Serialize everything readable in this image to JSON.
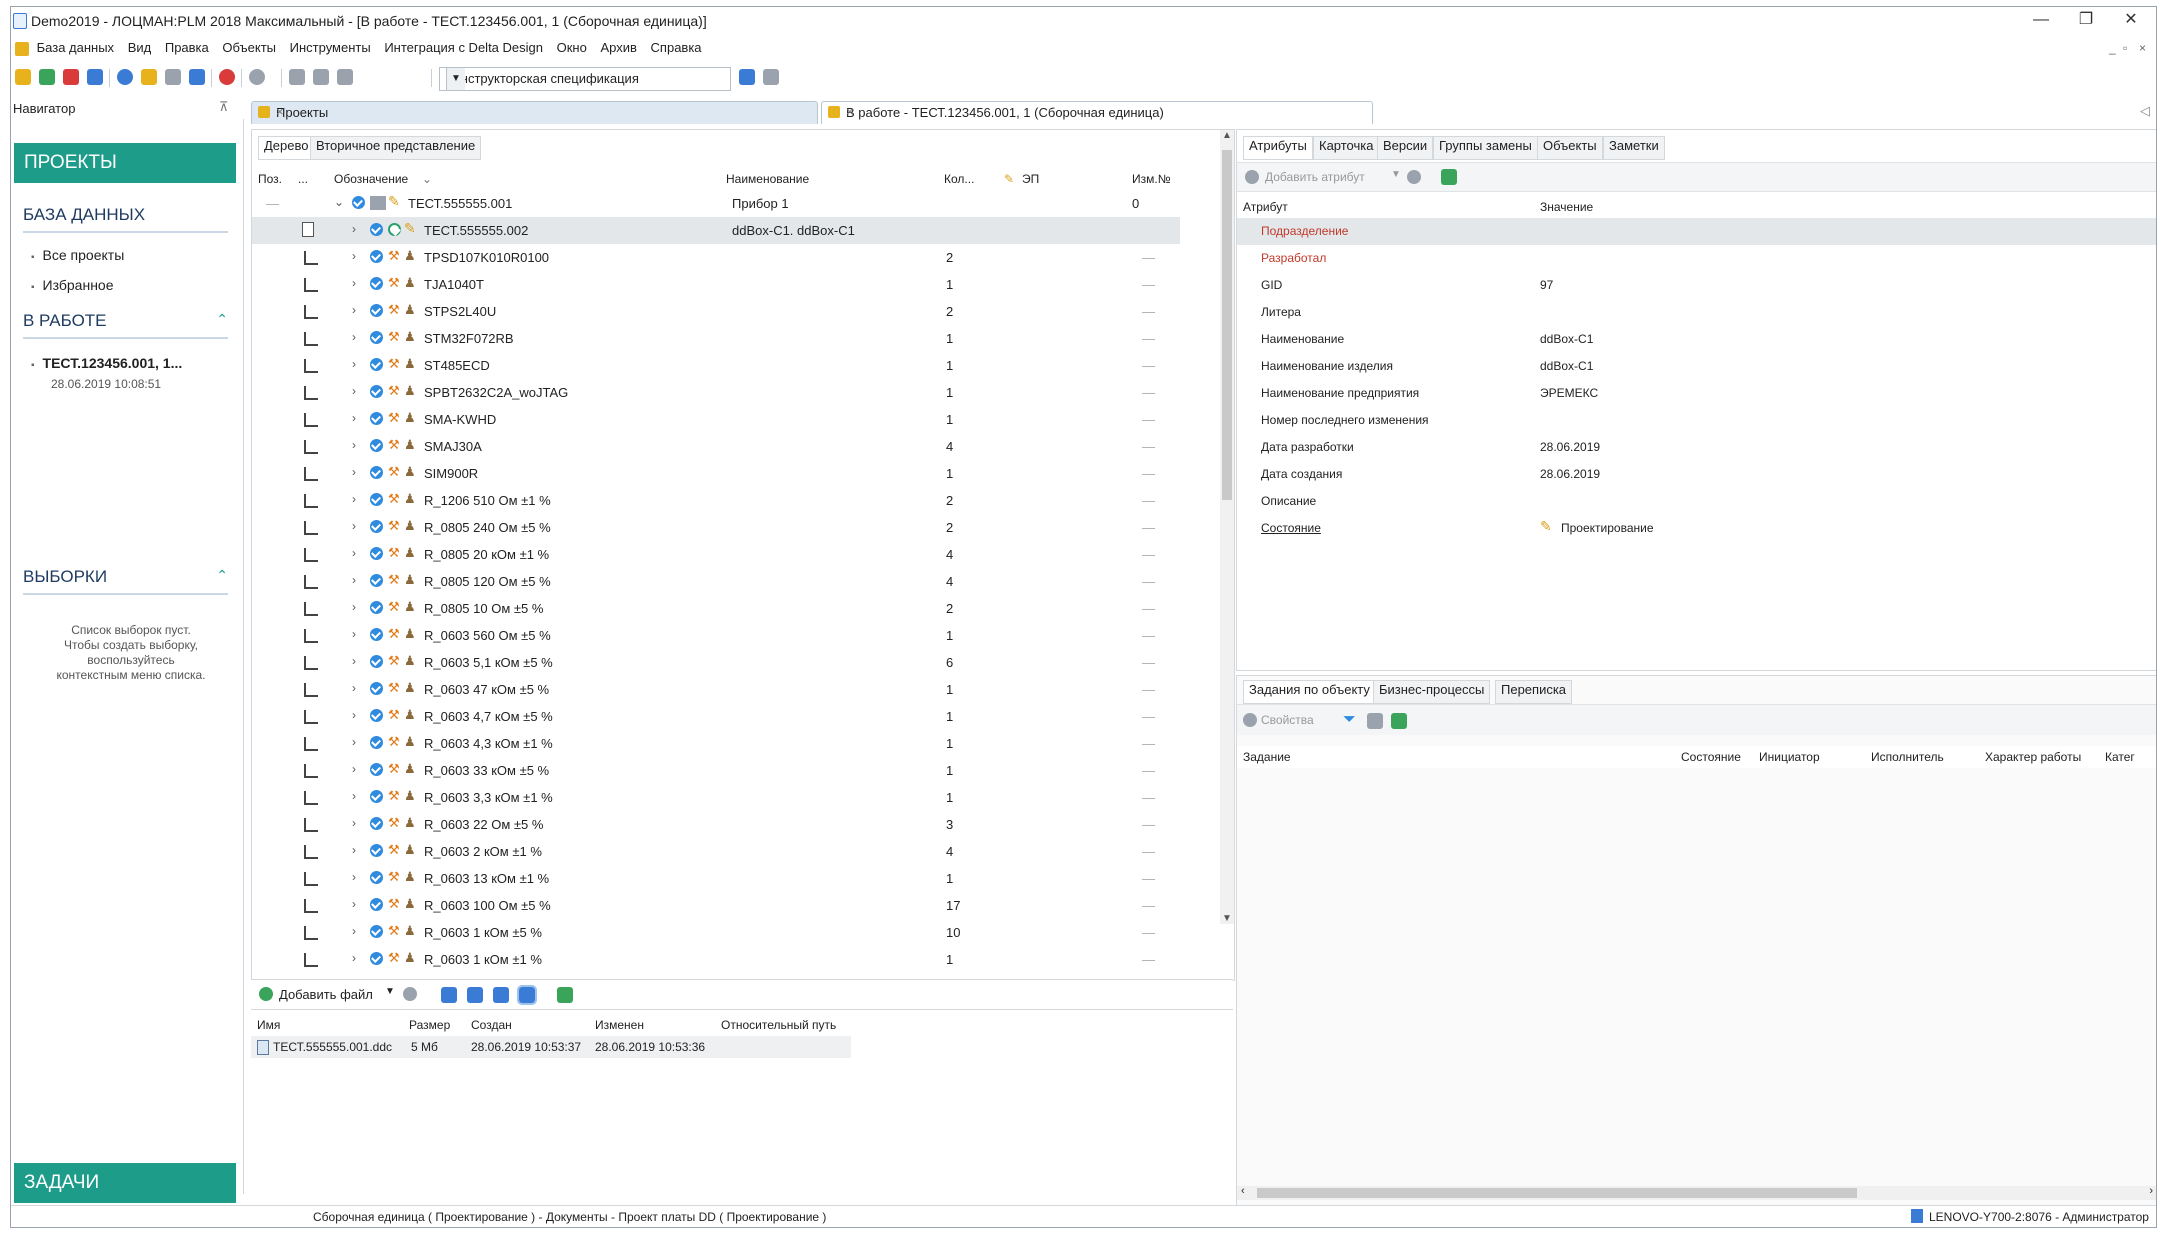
{
  "window": {
    "title": "Demo2019 - ЛОЦМАН:PLM 2018 Максимальный - [В работе - ТЕСТ.123456.001, 1 (Сборочная единица)]",
    "minimize": "—",
    "maximize": "❐",
    "close": "✕"
  },
  "menu": [
    "База данных",
    "Вид",
    "Правка",
    "Объекты",
    "Инструменты",
    "Интеграция с Delta Design",
    "Окно",
    "Архив",
    "Справка"
  ],
  "toolbar": {
    "spec_view": "Конструкторская спецификация"
  },
  "navigator": {
    "title": "Навигатор",
    "projects": "ПРОЕКТЫ",
    "database": "БАЗА ДАННЫХ",
    "db_items": [
      "Все проекты",
      "Избранное"
    ],
    "in_work": "В РАБОТЕ",
    "in_work_item": "ТЕСТ.123456.001, 1...",
    "in_work_date": "28.06.2019 10:08:51",
    "selections": "ВЫБОРКИ",
    "selections_empty": "Список выборок пуст.\nЧтобы создать выборку,\nвоспользуйтесь\nконтекстным меню списка.",
    "tasks": "ЗАДАЧИ"
  },
  "tabs": [
    {
      "label": "Проекты"
    },
    {
      "label": "В работе - ТЕСТ.123456.001, 1 (Сборочная единица)"
    }
  ],
  "tree": {
    "subtabs": [
      "Дерево",
      "Вторичное представление"
    ],
    "columns": {
      "pos": "Поз.",
      "more": "...",
      "designation": "Обозначение",
      "name": "Наименование",
      "qty": "Кол...",
      "ep": "ЭП",
      "change": "Изм.№"
    },
    "root": {
      "designation": "ТЕСТ.555555.001",
      "name": "Прибор 1",
      "change": "0"
    },
    "selected": {
      "designation": "ТЕСТ.555555.002",
      "name": "ddBox-C1. ddBox-C1"
    },
    "rows": [
      {
        "d": "TPSD107K010R0100",
        "q": "2"
      },
      {
        "d": "TJA1040T",
        "q": "1"
      },
      {
        "d": "STPS2L40U",
        "q": "2"
      },
      {
        "d": "STM32F072RB",
        "q": "1"
      },
      {
        "d": "ST485ECD",
        "q": "1"
      },
      {
        "d": "SPBT2632C2A_woJTAG",
        "q": "1"
      },
      {
        "d": "SMA-KWHD",
        "q": "1"
      },
      {
        "d": "SMAJ30A",
        "q": "4"
      },
      {
        "d": "SIM900R",
        "q": "1"
      },
      {
        "d": "R_1206 510 Ом ±1 %",
        "q": "2"
      },
      {
        "d": "R_0805 240 Ом ±5 %",
        "q": "2"
      },
      {
        "d": "R_0805 20 кОм ±1 %",
        "q": "4"
      },
      {
        "d": "R_0805 120 Ом ±5 %",
        "q": "4"
      },
      {
        "d": "R_0805 10 Ом ±5 %",
        "q": "2"
      },
      {
        "d": "R_0603 560 Ом ±5 %",
        "q": "1"
      },
      {
        "d": "R_0603 5,1 кОм ±5 %",
        "q": "6"
      },
      {
        "d": "R_0603 47 кОм ±5 %",
        "q": "1"
      },
      {
        "d": "R_0603 4,7 кОм ±5 %",
        "q": "1"
      },
      {
        "d": "R_0603 4,3 кОм ±1 %",
        "q": "1"
      },
      {
        "d": "R_0603 33 кОм ±5 %",
        "q": "1"
      },
      {
        "d": "R_0603 3,3 кОм ±1 %",
        "q": "1"
      },
      {
        "d": "R_0603 22 Ом ±5 %",
        "q": "3"
      },
      {
        "d": "R_0603 2 кОм ±1 %",
        "q": "4"
      },
      {
        "d": "R_0603 13 кОм ±1 %",
        "q": "1"
      },
      {
        "d": "R_0603 100 Ом ±5 %",
        "q": "17"
      },
      {
        "d": "R_0603 1 кОм ±5 %",
        "q": "10"
      },
      {
        "d": "R_0603 1 кОм ±1 %",
        "q": "1"
      }
    ],
    "dash": "—"
  },
  "files": {
    "add_file": "Добавить файл",
    "columns": [
      "Имя",
      "Размер",
      "Создан",
      "Изменен",
      "Относительный путь"
    ],
    "rows": [
      {
        "name": "ТЕСТ.555555.001.ddc",
        "size": "5 Мб",
        "created": "28.06.2019 10:53:37",
        "modified": "28.06.2019 10:53:36"
      }
    ]
  },
  "attributes": {
    "tabs": [
      "Атрибуты",
      "Карточка",
      "Версии",
      "Группы замены",
      "Объекты",
      "Заметки"
    ],
    "add_attr": "Добавить атрибут",
    "col_attr": "Атрибут",
    "col_value": "Значение",
    "rows": [
      {
        "k": "Подразделение",
        "v": ""
      },
      {
        "k": "Разработал",
        "v": ""
      },
      {
        "k": "GID",
        "v": "97"
      },
      {
        "k": "Литера",
        "v": ""
      },
      {
        "k": "Наименование",
        "v": "ddBox-C1"
      },
      {
        "k": "Наименование изделия",
        "v": "ddBox-C1"
      },
      {
        "k": "Наименование предприятия",
        "v": "ЭРЕМЕКС"
      },
      {
        "k": "Номер последнего изменения",
        "v": ""
      },
      {
        "k": "Дата разработки",
        "v": "28.06.2019"
      },
      {
        "k": "Дата создания",
        "v": "28.06.2019"
      },
      {
        "k": "Описание",
        "v": ""
      },
      {
        "k": "Состояние",
        "v": "Проектирование"
      }
    ]
  },
  "tasks": {
    "tabs": [
      "Задания по объекту",
      "Бизнес-процессы",
      "Переписка"
    ],
    "properties": "Свойства",
    "columns": [
      "Задание",
      "Состояние",
      "Инициатор",
      "Исполнитель",
      "Характер работы",
      "Катег"
    ]
  },
  "status": {
    "left": "Сборочная единица ( Проектирование ) - Документы - Проект платы DD ( Проектирование )",
    "right": "LENOVO-Y700-2:8076 - Администратор"
  },
  "colors": {
    "accent": "#1e9c8a",
    "required_attr": "#c0392b",
    "check": "#2f8bde"
  }
}
